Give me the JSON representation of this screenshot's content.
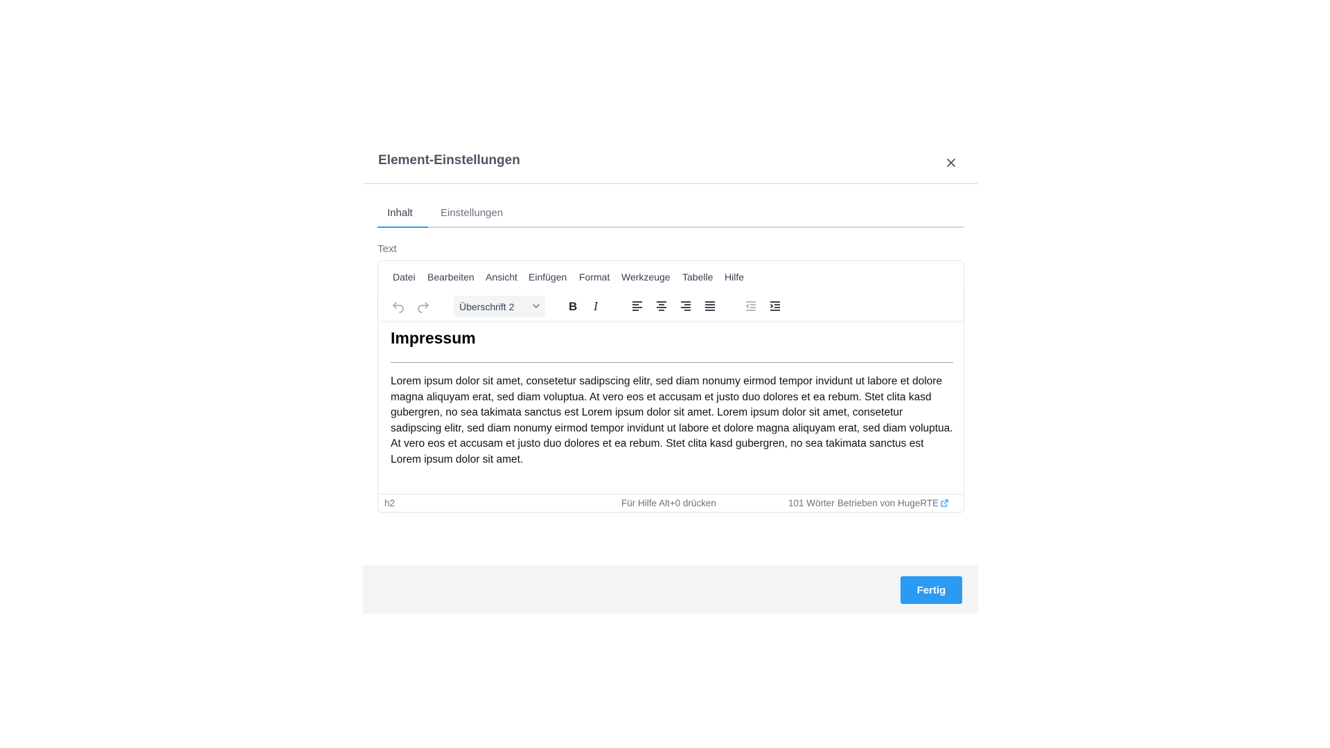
{
  "modal": {
    "title": "Element-Einstellungen",
    "close_icon": "close-icon"
  },
  "tabs": [
    {
      "label": "Inhalt",
      "active": true
    },
    {
      "label": "Einstellungen",
      "active": false
    }
  ],
  "field": {
    "label": "Text"
  },
  "editor": {
    "menu": [
      "Datei",
      "Bearbeiten",
      "Ansicht",
      "Einfügen",
      "Format",
      "Werkzeuge",
      "Tabelle",
      "Hilfe"
    ],
    "toolbar": {
      "block_format": "Überschrift 2",
      "icons": [
        "undo-icon",
        "redo-icon",
        "bold-icon",
        "italic-icon",
        "align-left-icon",
        "align-center-icon",
        "align-right-icon",
        "align-justify-icon",
        "outdent-icon",
        "indent-icon"
      ]
    },
    "content": {
      "heading": "Impressum",
      "paragraph": "Lorem ipsum dolor sit amet, consetetur sadipscing elitr, sed diam nonumy eirmod tempor invidunt ut labore et dolore magna aliquyam erat, sed diam voluptua. At vero eos et accusam et justo duo dolores et ea rebum. Stet clita kasd gubergren, no sea takimata sanctus est Lorem ipsum dolor sit amet. Lorem ipsum dolor sit amet, consetetur sadipscing elitr, sed diam nonumy eirmod tempor invidunt ut labore et dolore magna aliquyam erat, sed diam voluptua. At vero eos et accusam et justo duo dolores et ea rebum. Stet clita kasd gubergren, no sea takimata sanctus est Lorem ipsum dolor sit amet."
    },
    "status": {
      "path": "h2",
      "help": "Für Hilfe Alt+0 drücken",
      "words": "101 Wörter",
      "brand": "Betrieben von HugeRTE"
    }
  },
  "footer": {
    "done_label": "Fertig"
  },
  "colors": {
    "accent": "#2b9af3",
    "footer_bg": "#f3f4f6"
  }
}
